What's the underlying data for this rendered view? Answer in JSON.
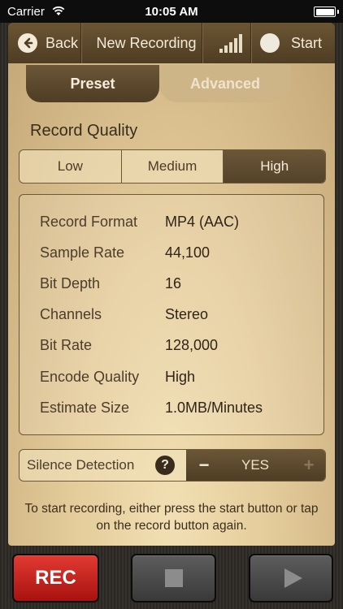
{
  "status_bar": {
    "carrier": "Carrier",
    "time": "10:05 AM"
  },
  "toolbar": {
    "back_label": "Back",
    "title": "New Recording",
    "start_label": "Start"
  },
  "tabs": [
    {
      "label": "Preset",
      "selected": true
    },
    {
      "label": "Advanced",
      "selected": false
    }
  ],
  "record_quality": {
    "title": "Record Quality",
    "options": [
      "Low",
      "Medium",
      "High"
    ],
    "selected": "High"
  },
  "details": [
    {
      "label": "Record Format",
      "value": "MP4 (AAC)"
    },
    {
      "label": "Sample Rate",
      "value": "44,100"
    },
    {
      "label": "Bit Depth",
      "value": "16"
    },
    {
      "label": "Channels",
      "value": "Stereo"
    },
    {
      "label": "Bit Rate",
      "value": "128,000"
    },
    {
      "label": "Encode Quality",
      "value": "High"
    },
    {
      "label": "Estimate Size",
      "value": "1.0MB/Minutes"
    }
  ],
  "silence_detection": {
    "label": "Silence Detection",
    "help_glyph": "?",
    "value": "YES",
    "minus": "−",
    "plus": "+"
  },
  "hint": "To start recording, either press the start button or tap on the record button again.",
  "controls": {
    "rec_label": "REC"
  },
  "colors": {
    "accent_brown": "#5a4529",
    "paper": "#e5cd9c",
    "rec_red": "#c8221d"
  }
}
